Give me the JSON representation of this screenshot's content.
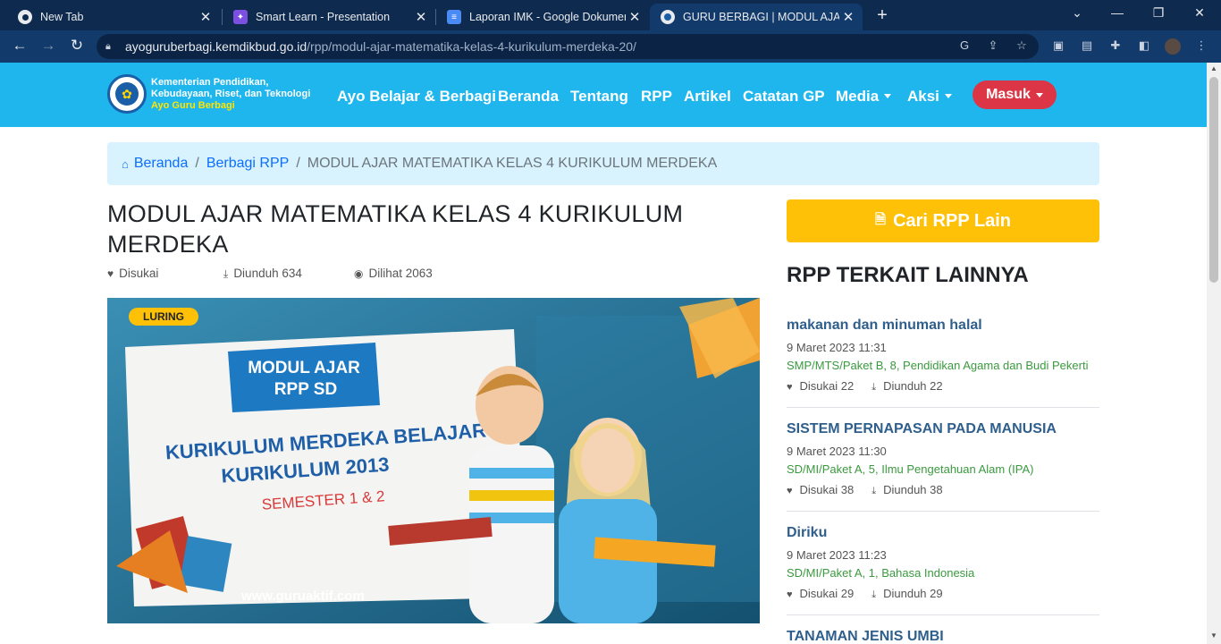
{
  "browser": {
    "tabs": [
      {
        "title": "New Tab",
        "favicon": "chrome-icon"
      },
      {
        "title": "Smart Learn - Presentation",
        "favicon": "canva-icon"
      },
      {
        "title": "Laporan IMK - Google Dokumen",
        "favicon": "docs-icon"
      },
      {
        "title": "GURU BERBAGI | MODUL AJAR M",
        "favicon": "kemdikbud-icon"
      }
    ],
    "url_host": "ayoguruberbagi.kemdikbud.go.id",
    "url_path": "/rpp/modul-ajar-matematika-kelas-4-kurikulum-merdeka-20/"
  },
  "header": {
    "org_line1": "Kementerian Pendidikan,",
    "org_line2": "Kebudayaan, Riset, dan Teknologi",
    "org_line3": "Ayo Guru Berbagi",
    "nav": [
      "Ayo Belajar & Berbagi",
      "Beranda",
      "Tentang",
      "RPP",
      "Artikel",
      "Catatan GP",
      "Media",
      "Aksi"
    ],
    "login": "Masuk"
  },
  "breadcrumb": {
    "home": "Beranda",
    "section": "Berbagi RPP",
    "current": "MODUL AJAR MATEMATIKA KELAS 4 KURIKULUM MERDEKA"
  },
  "article": {
    "title": "MODUL AJAR MATEMATIKA KELAS 4 KURIKULUM MERDEKA",
    "liked": "Disukai",
    "downloads": "Diunduh 634",
    "views": "Dilihat 2063",
    "badge": "LURING",
    "image": {
      "line1": "MODUL AJAR",
      "line2": "RPP SD",
      "line3": "KURIKULUM MERDEKA BELAJAR",
      "line4": "KURIKULUM 2013",
      "line5": "SEMESTER 1 & 2",
      "site": "www.guruaktif.com"
    }
  },
  "sidebar": {
    "search_button": "Cari RPP Lain",
    "heading": "RPP TERKAIT LAINNYA",
    "items": [
      {
        "title": "makanan dan minuman halal",
        "date": "9 Maret 2023 11:31",
        "category": "SMP/MTS/Paket B, 8, Pendidikan Agama dan Budi Pekerti",
        "likes": "Disukai 22",
        "downloads": "Diunduh 22"
      },
      {
        "title": "SISTEM PERNAPASAN PADA MANUSIA",
        "date": "9 Maret 2023 11:30",
        "category": "SD/MI/Paket A, 5, Ilmu Pengetahuan Alam (IPA)",
        "likes": "Disukai 38",
        "downloads": "Diunduh 38"
      },
      {
        "title": "Diriku",
        "date": "9 Maret 2023 11:23",
        "category": "SD/MI/Paket A, 1, Bahasa Indonesia",
        "likes": "Disukai 29",
        "downloads": "Diunduh 29"
      },
      {
        "title": "TANAMAN JENIS UMBI"
      }
    ]
  }
}
